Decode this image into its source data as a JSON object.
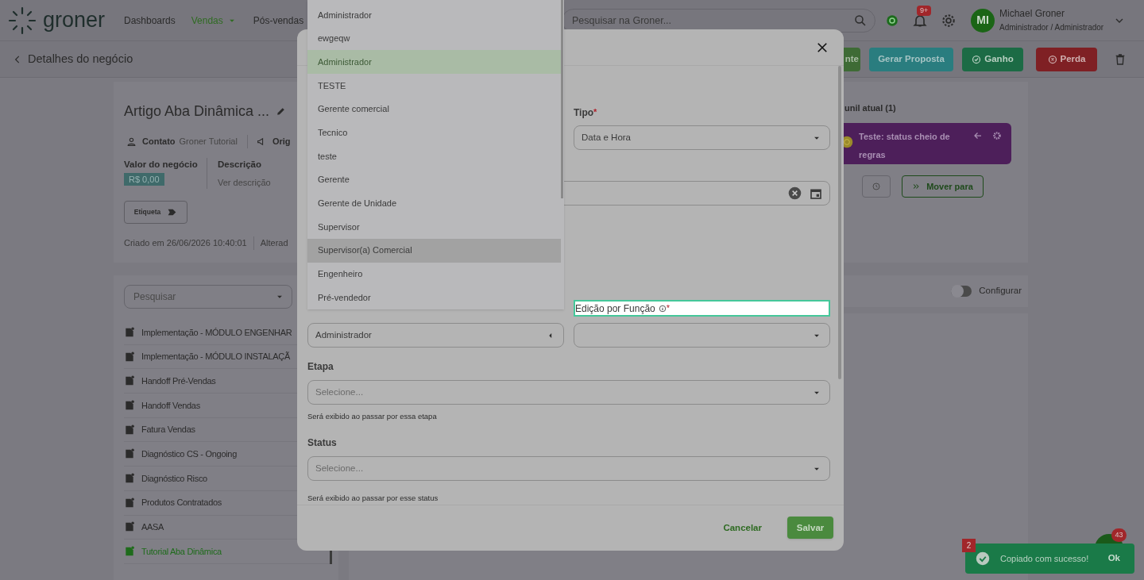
{
  "header": {
    "logo": "groner",
    "nav": [
      {
        "label": "Dashboards",
        "selected": false,
        "kind": "link"
      },
      {
        "label": "Vendas",
        "selected": true,
        "kind": "menu"
      },
      {
        "label": "Pós-vendas",
        "selected": false,
        "kind": "link"
      }
    ],
    "search": {
      "placeholder": "Pesquisar na Groner..."
    },
    "notification_badge": "9+",
    "user": {
      "initials": "MI",
      "name": "Michael Groner",
      "role": "Administrador / Administrador"
    }
  },
  "subheader": {
    "title": "Detalhes do negócio",
    "actions": [
      {
        "kind": "partial",
        "label": "nte"
      },
      {
        "kind": "proposal",
        "label": "Gerar Proposta"
      },
      {
        "kind": "won",
        "label": "Ganho"
      },
      {
        "kind": "lost",
        "label": "Perda"
      },
      {
        "kind": "delete"
      }
    ]
  },
  "deal": {
    "title": "Artigo Aba Dinâmica ...",
    "contact_label": "Contato",
    "contact_value": "Groner Tutorial",
    "origin_label": "Orig",
    "value_label": "Valor do negócio",
    "value": "R$ 0,00",
    "description_label": "Descrição",
    "description_link": "Ver descrição",
    "tag_button": "Etiqueta",
    "created": "Criado em 26/06/2026 10:40:01",
    "altered": "Alterad"
  },
  "tabs_panel": {
    "search_placeholder": "Pesquisar",
    "items": [
      {
        "label": "Implementação - MÓDULO ENGENHAR",
        "selected": false
      },
      {
        "label": "Implementação - MÓDULO INSTALAÇÃ",
        "selected": false
      },
      {
        "label": "Handoff Pré-Vendas",
        "selected": false
      },
      {
        "label": "Handoff Vendas",
        "selected": false
      },
      {
        "label": "Fatura Vendas",
        "selected": false
      },
      {
        "label": "Diagnóstico CS - Ongoing",
        "selected": false
      },
      {
        "label": "Diagnóstico Risco",
        "selected": false
      },
      {
        "label": "Produtos Contratados",
        "selected": false
      },
      {
        "label": "AASA",
        "selected": false
      },
      {
        "label": "Tutorial Aba Dinâmica",
        "selected": true
      }
    ]
  },
  "funnel": {
    "title": "unil atual (1)",
    "status_card": "Teste: status cheio de regras",
    "move_button": "Mover para",
    "toggle": {
      "label": "Configurar",
      "on": false
    }
  },
  "modal": {
    "type_label": "Tipo",
    "type_required": "*",
    "type_value": "Data e Hora",
    "view_value": "Administrador",
    "edit_label": "Edição por Função",
    "edit_required": "*",
    "stage_label": "Etapa",
    "stage_placeholder": "Selecione...",
    "stage_hint": "Será exibido ao passar por essa etapa",
    "status_label": "Status",
    "status_placeholder": "Selecione...",
    "status_hint": "Será exibido ao passar por esse status",
    "cancel": "Cancelar",
    "save": "Salvar"
  },
  "dropdown": {
    "items": [
      {
        "label": "Administrador",
        "selected": false,
        "highlighted": false
      },
      {
        "label": "ewgeqw",
        "selected": false,
        "highlighted": false
      },
      {
        "label": "Administrador",
        "selected": true,
        "highlighted": false
      },
      {
        "label": "TESTE",
        "selected": false,
        "highlighted": false
      },
      {
        "label": "Gerente comercial",
        "selected": false,
        "highlighted": false
      },
      {
        "label": "Tecnico",
        "selected": false,
        "highlighted": false
      },
      {
        "label": "teste",
        "selected": false,
        "highlighted": false
      },
      {
        "label": "Gerente",
        "selected": false,
        "highlighted": false
      },
      {
        "label": "Gerente de Unidade",
        "selected": false,
        "highlighted": false
      },
      {
        "label": "Supervisor",
        "selected": false,
        "highlighted": false
      },
      {
        "label": "Supervisor(a) Comercial",
        "selected": false,
        "highlighted": true
      },
      {
        "label": "Engenheiro",
        "selected": false,
        "highlighted": false
      },
      {
        "label": "Pré-vendedor",
        "selected": false,
        "highlighted": false
      }
    ]
  },
  "toast": {
    "count": "2",
    "message": "Copiado com sucesso!",
    "action": "Ok"
  },
  "chat": {
    "badge": "43"
  }
}
